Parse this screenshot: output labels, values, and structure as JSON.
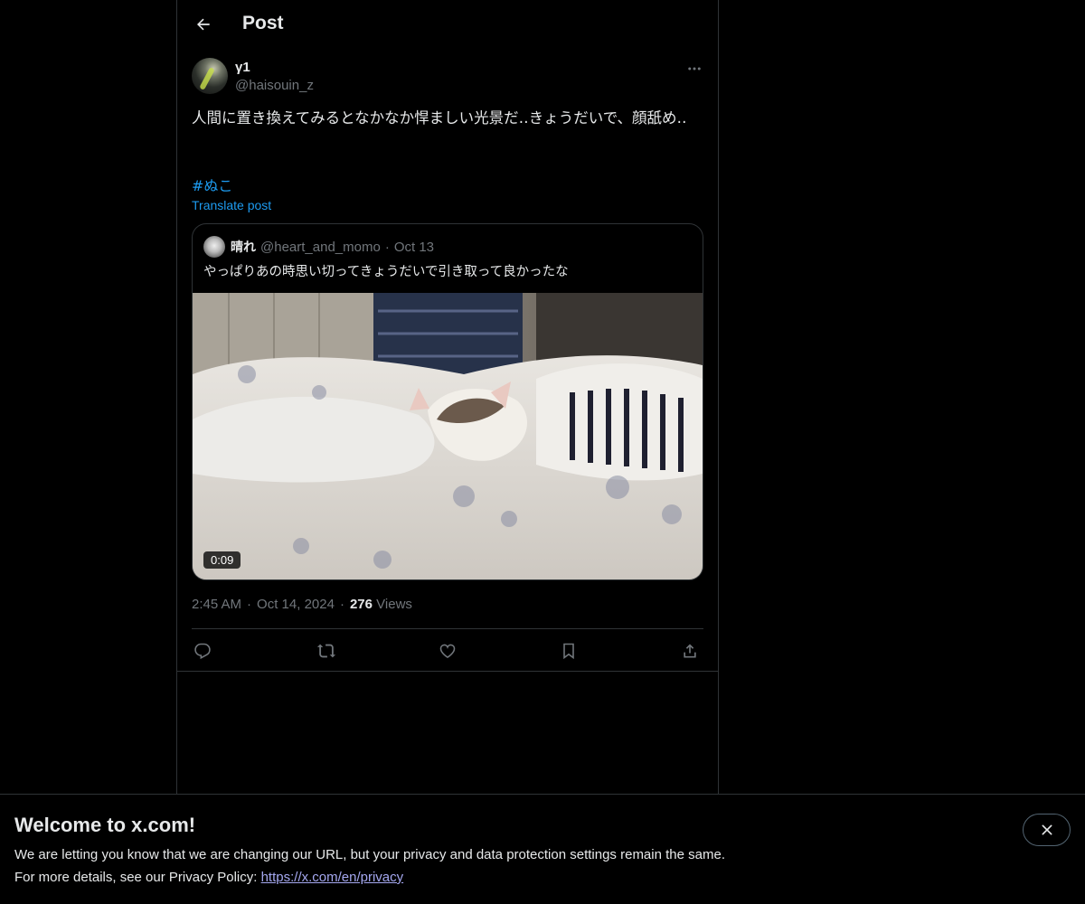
{
  "header": {
    "title": "Post"
  },
  "post": {
    "author_name": "γ1",
    "author_handle": "@haisouin_z",
    "text": "人間に置き換えてみるとなかなか悍ましい光景だ‥きょうだいで、顔舐め‥",
    "hashtag": "#ぬこ",
    "translate_label": "Translate post",
    "time": "2:45 AM",
    "date": "Oct 14, 2024",
    "views_count": "276",
    "views_label": "Views",
    "separator": "·"
  },
  "quoted": {
    "name": "晴れ",
    "handle": "@heart_and_momo",
    "separator": "·",
    "date": "Oct 13",
    "text": "やっぱりあの時思い切ってきょうだいで引き取って良かったな",
    "video_duration": "0:09"
  },
  "actions": {
    "icons": [
      "reply-icon",
      "repost-icon",
      "like-icon",
      "bookmark-icon",
      "share-icon"
    ]
  },
  "banner": {
    "title": "Welcome to x.com!",
    "line1": "We are letting you know that we are changing our URL, but your privacy and data protection settings remain the same.",
    "line2_prefix": "For more details, see our Privacy Policy: ",
    "link": "https://x.com/en/privacy"
  },
  "colors": {
    "background": "#000000",
    "text": "#e7e9ea",
    "muted": "#71767b",
    "accent": "#1d9bf0",
    "border": "#2f3336"
  }
}
